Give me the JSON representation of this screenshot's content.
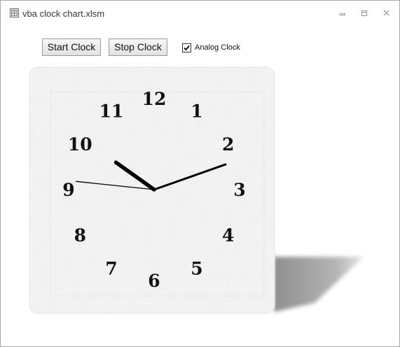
{
  "window": {
    "title": "vba clock chart.xlsm"
  },
  "toolbar": {
    "start_label": "Start Clock",
    "stop_label": "Stop Clock",
    "analog_label": "Analog Clock",
    "analog_checked": true
  },
  "clock": {
    "numbers": [
      "12",
      "1",
      "2",
      "3",
      "4",
      "5",
      "6",
      "7",
      "8",
      "9",
      "10",
      "11"
    ],
    "time": {
      "hour": 10,
      "minute": 11,
      "second": 46
    },
    "face_color": "#f0f0f0",
    "hand_color": "#000000",
    "shadow_color": "#9e9e9e"
  },
  "icons": {
    "app": "excel-file-icon",
    "minimize": "minimize-icon",
    "restore": "restore-icon",
    "close": "close-icon",
    "check": "checkmark-icon"
  }
}
